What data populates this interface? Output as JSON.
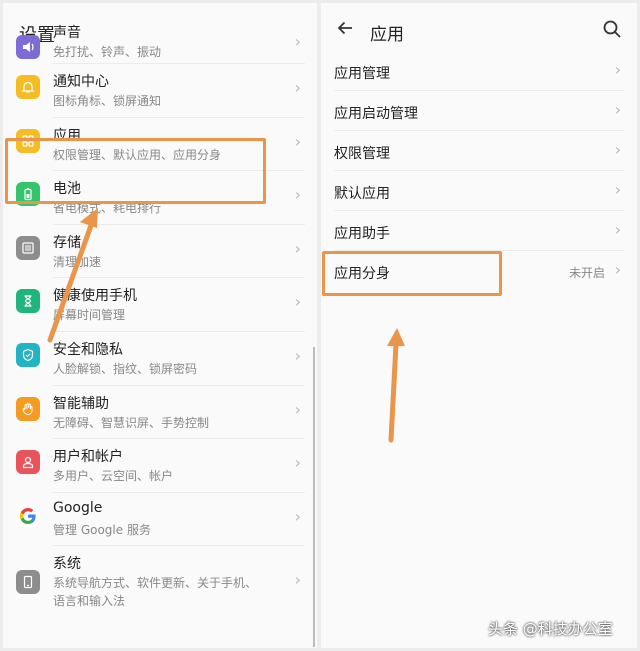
{
  "left": {
    "title": "设置",
    "items": [
      {
        "title": "声音",
        "subtitle": "免打扰、铃声、振动",
        "icon": "sound-icon",
        "color": "#7e6bd6"
      },
      {
        "title": "通知中心",
        "subtitle": "图标角标、锁屏通知",
        "icon": "bell-icon",
        "color": "#f5bd23"
      },
      {
        "title": "应用",
        "subtitle": "权限管理、默认应用、应用分身",
        "icon": "apps-grid-icon",
        "color": "#f5bd23"
      },
      {
        "title": "电池",
        "subtitle": "省电模式、耗电排行",
        "icon": "battery-icon",
        "color": "#34c46b"
      },
      {
        "title": "存储",
        "subtitle": "清理加速",
        "icon": "storage-icon",
        "color": "#8d8d8d"
      },
      {
        "title": "健康使用手机",
        "subtitle": "屏幕时间管理",
        "icon": "hourglass-icon",
        "color": "#1fb57d"
      },
      {
        "title": "安全和隐私",
        "subtitle": "人脸解锁、指纹、锁屏密码",
        "icon": "shield-icon",
        "color": "#22b4c4"
      },
      {
        "title": "智能辅助",
        "subtitle": "无障碍、智慧识屏、手势控制",
        "icon": "hand-icon",
        "color": "#f39c20"
      },
      {
        "title": "用户和帐户",
        "subtitle": "多用户、云空间、帐户",
        "icon": "user-icon",
        "color": "#e9545a"
      },
      {
        "title": "Google",
        "subtitle": "管理 Google 服务",
        "icon": "google-icon",
        "color": "#ffffff"
      },
      {
        "title": "系统",
        "subtitle": "系统导航方式、软件更新、关于手机、",
        "subtitle2": "语言和输入法",
        "icon": "phone-icon",
        "color": "#8d8d8d"
      }
    ]
  },
  "right": {
    "title": "应用",
    "items": [
      {
        "label": "应用管理"
      },
      {
        "label": "应用启动管理"
      },
      {
        "label": "权限管理"
      },
      {
        "label": "默认应用"
      },
      {
        "label": "应用助手"
      },
      {
        "label": "应用分身",
        "status": "未开启"
      }
    ]
  },
  "watermark": "头条 @科技办公室",
  "accent": "#e9954a"
}
